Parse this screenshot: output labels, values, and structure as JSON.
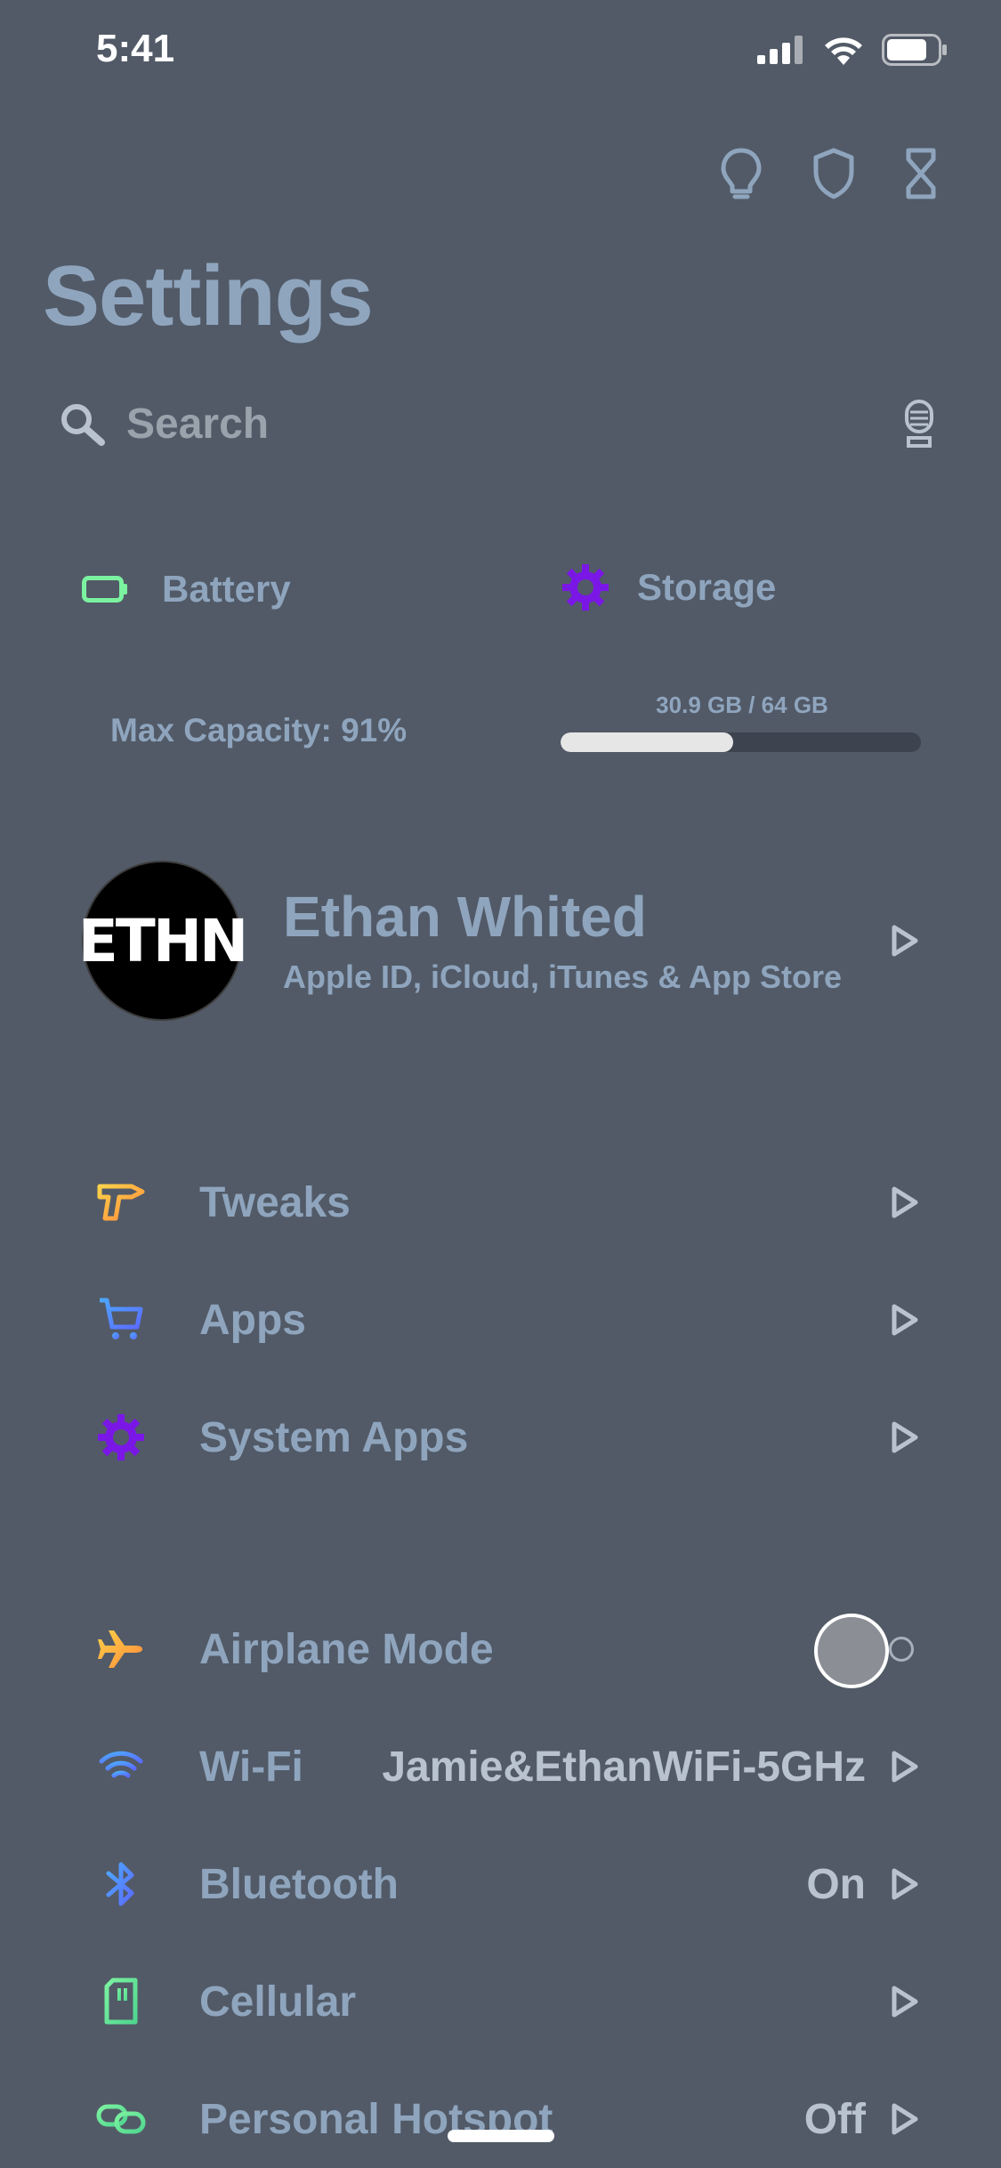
{
  "status_bar": {
    "time": "5:41"
  },
  "header": {
    "title": "Settings",
    "actions": [
      "lightbulb-icon",
      "shield-icon",
      "hourglass-icon"
    ]
  },
  "search": {
    "placeholder": "Search"
  },
  "tiles": {
    "battery": {
      "label": "Battery",
      "detail": "Max Capacity: 91%",
      "accent": "#7cf2a0"
    },
    "storage": {
      "label": "Storage",
      "detail": "30.9 GB / 64 GB",
      "used_fraction": 0.48,
      "accent": "#7a17e6"
    }
  },
  "profile": {
    "avatar_text": "ETHN",
    "name": "Ethan Whited",
    "subtitle": "Apple ID, iCloud, iTunes & App Store"
  },
  "group1": [
    {
      "label": "Tweaks",
      "icon": "drill-icon"
    },
    {
      "label": "Apps",
      "icon": "cart-icon"
    },
    {
      "label": "System Apps",
      "icon": "gear-icon"
    }
  ],
  "group2": [
    {
      "label": "Airplane Mode",
      "icon": "airplane-icon",
      "toggle": false
    },
    {
      "label": "Wi-Fi",
      "icon": "wifi-icon",
      "value": "Jamie&EthanWiFi-5GHz"
    },
    {
      "label": "Bluetooth",
      "icon": "bluetooth-icon",
      "value": "On"
    },
    {
      "label": "Cellular",
      "icon": "sim-icon"
    },
    {
      "label": "Personal Hotspot",
      "icon": "link-icon",
      "value": "Off"
    }
  ]
}
